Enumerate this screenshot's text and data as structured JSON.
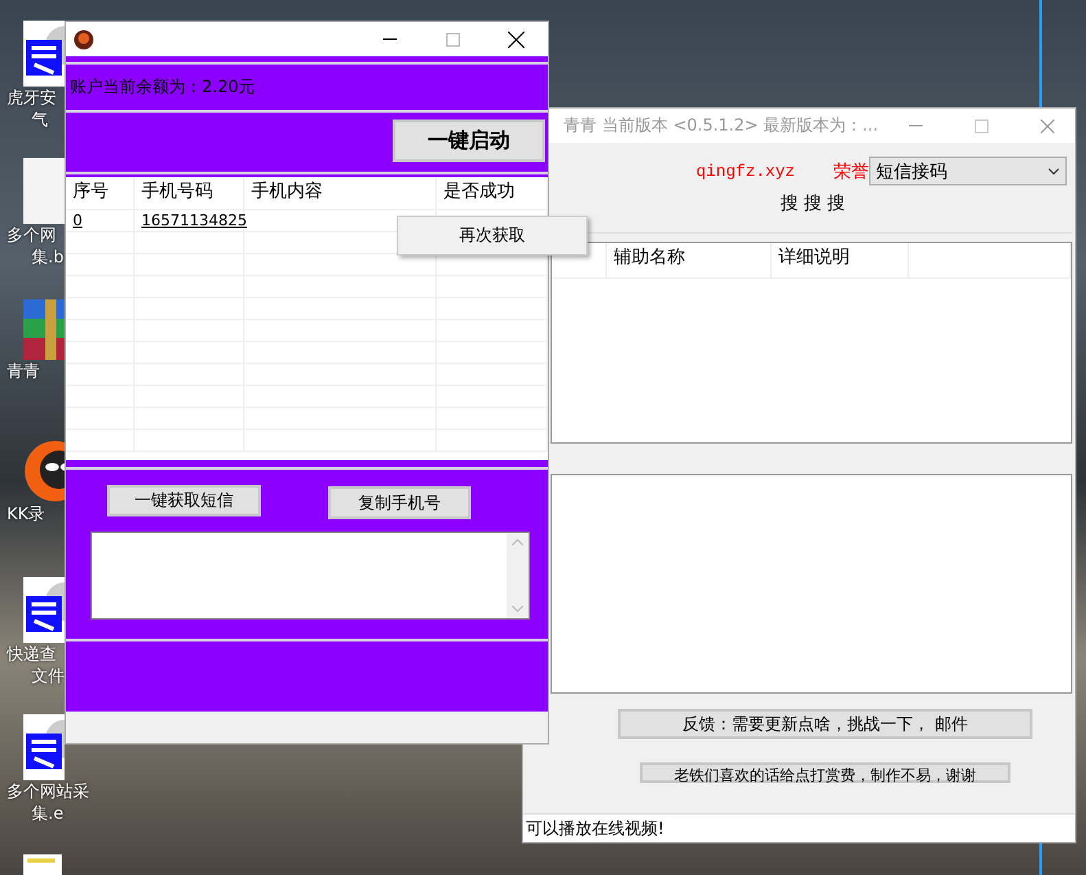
{
  "desktop": {
    "icons": [
      {
        "kind": "easy",
        "lines": [
          "虎牙安",
          "气"
        ]
      },
      {
        "kind": "blank",
        "lines": [
          "多个网",
          "集.b"
        ]
      },
      {
        "kind": "archive",
        "lines": [
          "青青"
        ]
      },
      {
        "kind": "cat",
        "lines": [
          "KK录"
        ]
      },
      {
        "kind": "easy",
        "lines": [
          "快递查",
          "文件"
        ]
      },
      {
        "kind": "easy",
        "lines": [
          "多个网站采",
          "集.e"
        ]
      },
      {
        "kind": "doc"
      }
    ]
  },
  "back_window": {
    "title": "青青  当前版本 <0.5.1.2>  最新版本为：...",
    "site": "qingfz.xyz",
    "honor": "荣誉",
    "select_value": "短信接码",
    "search_label": "搜 搜 搜",
    "table": {
      "columns": [
        "辅助名称",
        "详细说明"
      ]
    },
    "buttons": [
      "反馈：需要更新点啥，挑战一下，  邮件",
      "老铁们喜欢的话给点打赏费，制作不易，谢谢"
    ],
    "status": "可以播放在线视频!"
  },
  "front_window": {
    "balance": "账户当前余额为：2.20元",
    "start_button": "一键启动",
    "table": {
      "columns": [
        "序号",
        "手机号码",
        "手机内容",
        "是否成功"
      ],
      "rows": [
        [
          "0",
          "16571134825",
          "",
          ""
        ]
      ]
    },
    "context_menu": {
      "items": [
        "再次获取"
      ]
    },
    "buttons": [
      "一键获取短信",
      "复制手机号"
    ]
  }
}
